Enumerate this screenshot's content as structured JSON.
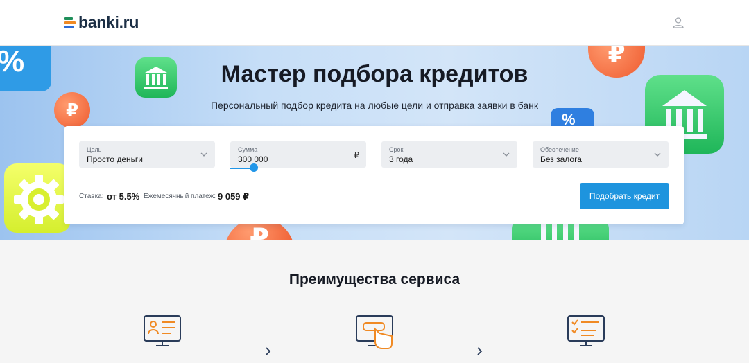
{
  "header": {
    "logo_text": "banki.ru",
    "user_icon": "user-icon"
  },
  "hero": {
    "title": "Мастер подбора кредитов",
    "subtitle": "Персональный подбор кредита на любые цели и отправка заявки в банк",
    "deco_percent": "%",
    "deco_rub": "₽"
  },
  "form": {
    "purpose": {
      "label": "Цель",
      "value": "Просто деньги"
    },
    "amount": {
      "label": "Сумма",
      "value": "300 000",
      "currency": "₽",
      "slider_fraction": 0.15
    },
    "term": {
      "label": "Срок",
      "value": "3 года"
    },
    "collateral": {
      "label": "Обеспечение",
      "value": "Без залога"
    },
    "rate_label": "Ставка:",
    "rate_value": "от 5.5%",
    "payment_label": "Ежемесячный платеж:",
    "payment_value": "9 059 ₽",
    "submit_label": "Подобрать кредит"
  },
  "advantages": {
    "title": "Преимущества сервиса"
  },
  "colors": {
    "accent": "#1e94de",
    "logo_green": "#1f8f5a",
    "logo_orange": "#f08a24",
    "logo_blue": "#2d6bd6"
  }
}
